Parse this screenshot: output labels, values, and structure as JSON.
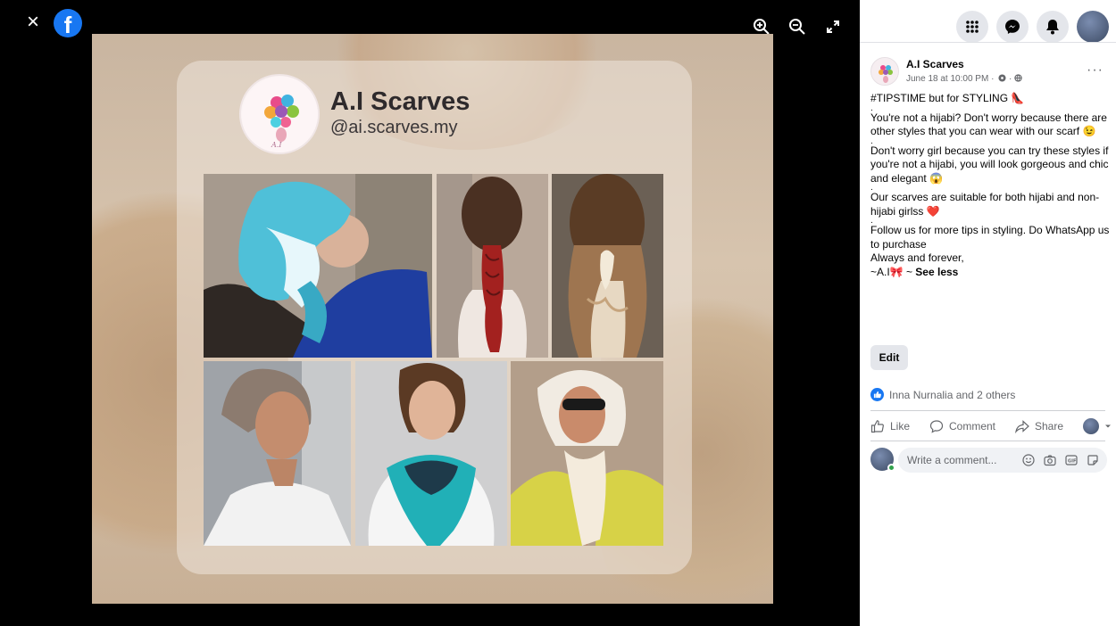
{
  "viewer": {
    "close_glyph": "×",
    "logo_glyph": "f",
    "tools": [
      "zoom-in-icon",
      "zoom-out-icon",
      "fullscreen-icon"
    ]
  },
  "image": {
    "brand_name": "A.I Scarves",
    "brand_handle": "@ai.scarves.my"
  },
  "topbar": {
    "icons": [
      "menu-grid-icon",
      "messenger-icon",
      "notifications-icon",
      "profile-avatar"
    ]
  },
  "post": {
    "page_name": "A.I Scarves",
    "timestamp": "June 18 at 10:00 PM ·",
    "more_glyph": "···",
    "lines": [
      "#TIPSTIME but for STYLING 👠",
      ".",
      "You're not a hijabi? Don't worry because there are other styles that you can wear with our scarf 😉",
      ".",
      "Don't worry girl because you can try these styles if you're not a hijabi, you will look gorgeous and chic and elegant 😱",
      ".",
      "Our scarves are suitable for both hijabi and non-hijabi girlss ❤️",
      ".",
      "Follow us for more tips in styling. Do WhatsApp us to purchase",
      "Always and forever,"
    ],
    "signature": "~A.I🎀 ~ ",
    "see_less": "See less",
    "edit_label": "Edit",
    "reactions_text": "Inna Nurnalia and 2 others",
    "actions": {
      "like": "Like",
      "comment": "Comment",
      "share": "Share"
    },
    "comment_placeholder": "Write a comment..."
  },
  "colors": {
    "accent": "#1877f2",
    "panel_bg": "#ffffff",
    "viewer_bg": "#000000"
  }
}
